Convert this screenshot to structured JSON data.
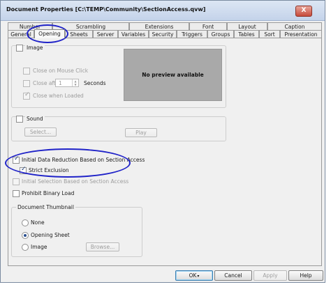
{
  "window": {
    "title": "Document Properties [C:\\TEMP\\Community\\SectionAccess.qvw]",
    "close_label": "X"
  },
  "tabs_row1": [
    "Number",
    "Scrambling",
    "Extensions",
    "Font",
    "Layout",
    "Caption"
  ],
  "tabs_row2": [
    "General",
    "Opening",
    "Sheets",
    "Server",
    "Variables",
    "Security",
    "Triggers",
    "Groups",
    "Tables",
    "Sort",
    "Presentation"
  ],
  "active_tab": "Opening",
  "image_group": {
    "label": "Image",
    "checked": false,
    "close_on_click": {
      "label": "Close on Mouse Click",
      "checked": false,
      "enabled": false
    },
    "close_after": {
      "label": "Close after",
      "checked": false,
      "enabled": false,
      "value": "1",
      "unit": "Seconds"
    },
    "close_when_loaded": {
      "label": "Close when Loaded",
      "checked": true,
      "enabled": false
    },
    "preview_text": "No preview available"
  },
  "sound_group": {
    "label": "Sound",
    "checked": false,
    "select_label": "Select...",
    "play_label": "Play"
  },
  "initial_data_reduction": {
    "label": "Initial Data Reduction Based on Section Access",
    "checked": true
  },
  "strict_exclusion": {
    "label": "Strict Exclusion",
    "checked": true
  },
  "initial_selection": {
    "label": "Initial Selection Based on Section Access",
    "checked": false,
    "enabled": false
  },
  "prohibit_binary": {
    "label": "Prohibit Binary Load",
    "checked": false
  },
  "thumbnail": {
    "label": "Document Thumbnail",
    "options": [
      "None",
      "Opening Sheet",
      "Image"
    ],
    "selected": "Opening Sheet",
    "browse_label": "Browse..."
  },
  "buttons": {
    "ok": "OK",
    "cancel": "Cancel",
    "apply": "Apply",
    "help": "Help"
  },
  "colors": {
    "annotation": "#1f22c8",
    "preview_bg": "#a9a9a9",
    "titlebar": "#c4d3ea"
  }
}
